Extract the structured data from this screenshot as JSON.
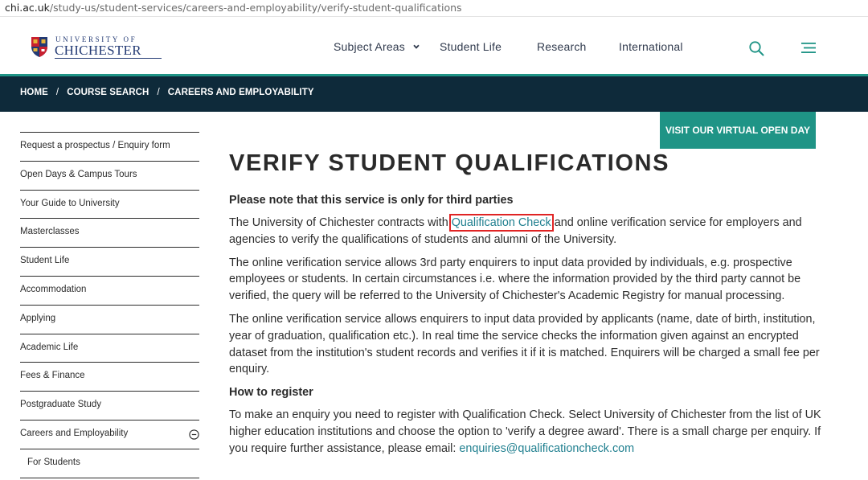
{
  "browser": {
    "url_host": "chi.ac.uk",
    "url_path": "/study-us/student-services/careers-and-employability/verify-student-qualifications"
  },
  "header": {
    "logo_top": "UNIVERSITY OF",
    "logo_name": "CHICHESTER",
    "nav": [
      {
        "label": "Subject Areas"
      },
      {
        "label": "Student Life"
      },
      {
        "label": "Research"
      },
      {
        "label": "International"
      }
    ],
    "search_icon": "search-icon",
    "menu_icon": "hamburger-menu-icon",
    "accent": "#1f9486"
  },
  "breadcrumb": {
    "items": [
      "HOME",
      "COURSE SEARCH",
      "CAREERS AND EMPLOYABILITY"
    ],
    "separator": "/",
    "bg": "#0e2a3a"
  },
  "sidebar": {
    "items": [
      {
        "label": "Request a prospectus / Enquiry form"
      },
      {
        "label": "Open Days & Campus Tours"
      },
      {
        "label": "Your Guide to University"
      },
      {
        "label": "Masterclasses"
      },
      {
        "label": "Student Life"
      },
      {
        "label": "Accommodation"
      },
      {
        "label": "Applying"
      },
      {
        "label": "Academic Life"
      },
      {
        "label": "Fees & Finance"
      },
      {
        "label": "Postgraduate Study"
      },
      {
        "label": "Careers and Employability",
        "expanded": true
      },
      {
        "label": "For Students"
      }
    ]
  },
  "cta": {
    "label": "VISIT OUR VIRTUAL OPEN DAY"
  },
  "main": {
    "title": "VERIFY STUDENT QUALIFICATIONS",
    "notice": "Please note that this service is only for third parties",
    "p1_before": "The University of Chichester contracts with ",
    "p1_link": "Qualification Check",
    "p1_after": " and online verification service for employers and agencies to verify the qualifications of students and alumni of the University.",
    "p2": "The online verification service allows 3rd party enquirers to input data provided by individuals, e.g. prospective employees or students.  In certain circumstances i.e. where the information provided by the third party cannot be verified, the query will be referred to the University of Chichester's Academic Registry for manual processing.",
    "p3": "The online verification service allows enquirers to input data provided by applicants (name, date of birth, institution, year of graduation, qualification etc.).  In real time the service checks the information given against an encrypted dataset from the institution's student records and verifies it if it is matched.  Enquirers will be charged a small fee per enquiry.",
    "register_heading": "How to register",
    "p4_before": "To make an enquiry you need to register with Qualification Check.  Select University of Chichester from the list of UK higher education institutions and choose the option to 'verify a degree award'. There is a small charge per enquiry. If you require further assistance, please email: ",
    "p4_email": "enquiries@qualificationcheck.com",
    "highlight_color": "#e02424"
  }
}
